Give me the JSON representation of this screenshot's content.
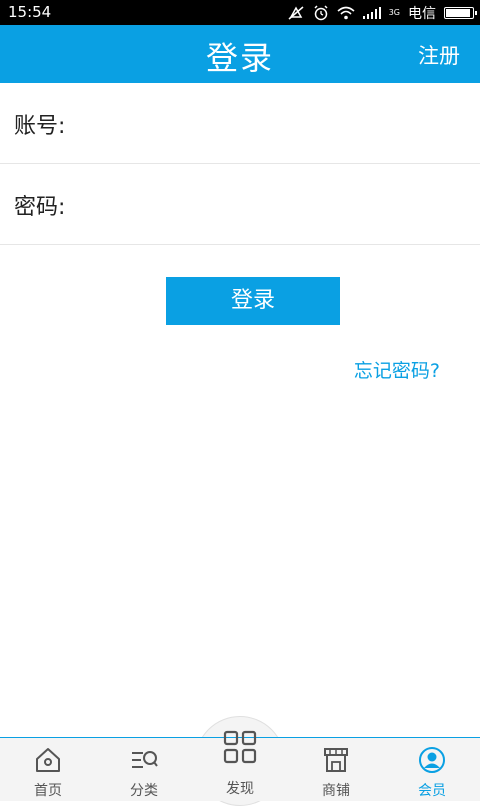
{
  "status": {
    "time": "15:54",
    "network": "3G",
    "carrier": "电信",
    "battery_level": 0.85
  },
  "header": {
    "title": "登录",
    "register": "注册"
  },
  "form": {
    "account_label": "账号:",
    "account_value": "",
    "password_label": "密码:",
    "password_value": "",
    "login_button": "登录",
    "forgot_password": "忘记密码?"
  },
  "tabs": [
    {
      "label": "首页",
      "icon": "home-icon"
    },
    {
      "label": "分类",
      "icon": "category-search-icon"
    },
    {
      "label": "发现",
      "icon": "grid-icon"
    },
    {
      "label": "商铺",
      "icon": "store-icon"
    },
    {
      "label": "会员",
      "icon": "user-icon",
      "active": true
    }
  ],
  "colors": {
    "primary": "#0aa0e3",
    "background": "#ffffff",
    "tabbar": "#f4f4f4"
  }
}
